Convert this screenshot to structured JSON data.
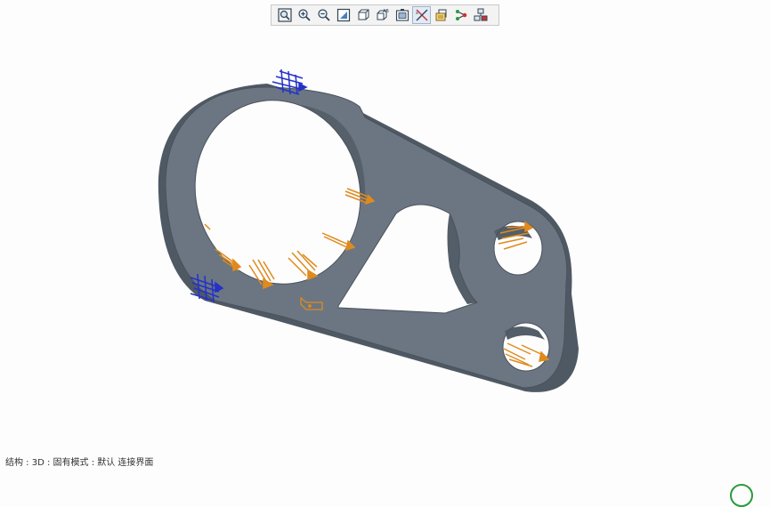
{
  "toolbar": {
    "buttons": [
      {
        "icon": "refit-view-icon"
      },
      {
        "icon": "zoom-in-icon"
      },
      {
        "icon": "zoom-out-icon"
      },
      {
        "icon": "repaint-icon"
      },
      {
        "icon": "display-style-icon"
      },
      {
        "icon": "saved-orientations-icon"
      },
      {
        "icon": "view-manager-icon"
      },
      {
        "icon": "datum-display-icon"
      },
      {
        "icon": "annotation-display-icon"
      },
      {
        "icon": "spin-center-icon"
      },
      {
        "icon": "simulation-display-icon"
      }
    ]
  },
  "status_bar": {
    "text": "结构 : 3D : 固有模式 : 默认 连接界面"
  },
  "colors": {
    "part_body": "#6b7682",
    "part_edge": "#4a525b",
    "load_arrows": "#e08a1e",
    "constraint_arrows": "#2431c8",
    "accent": "#2a9a3c"
  }
}
